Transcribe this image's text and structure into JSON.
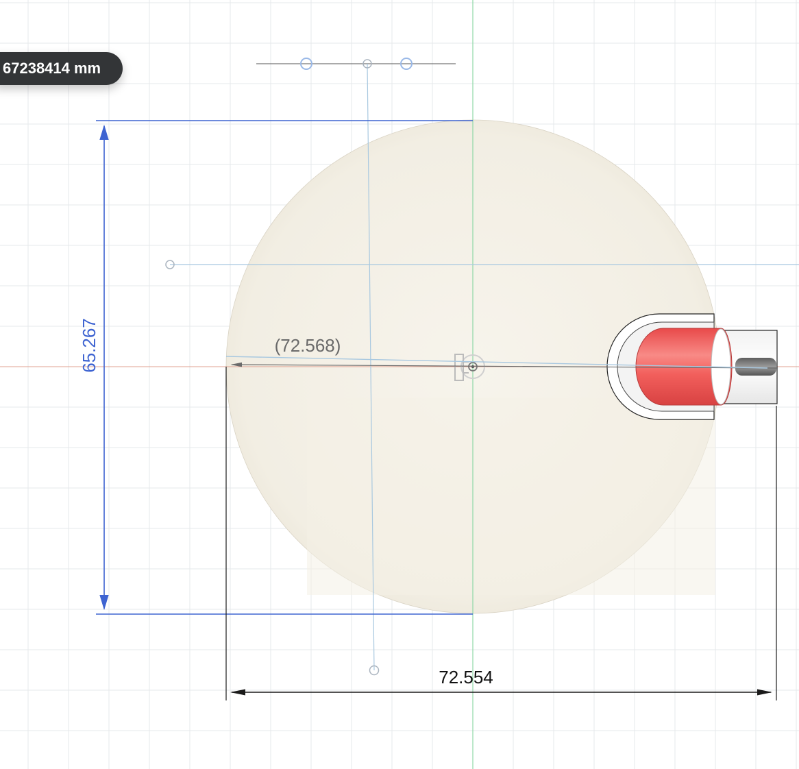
{
  "measure_readout": {
    "value_text": "67238414 mm"
  },
  "dimensions": {
    "vertical": "65.267",
    "horizontal": "72.554",
    "reference": "(72.568)"
  },
  "colors": {
    "canvas_background": "#ffffff",
    "grid_line": "#e6e8eb",
    "sphere_fill": "#f4f0e6",
    "dimension_blue": "#3d63d1",
    "dimension_black": "#1a1a1a",
    "reference_gray": "#6a6a6a",
    "axis_green": "#8fd8a6",
    "axis_red": "#e0a090",
    "sketch_line": "#a8c8e0",
    "handle_red": "#f05a5a",
    "readout_bg": "#333537"
  }
}
